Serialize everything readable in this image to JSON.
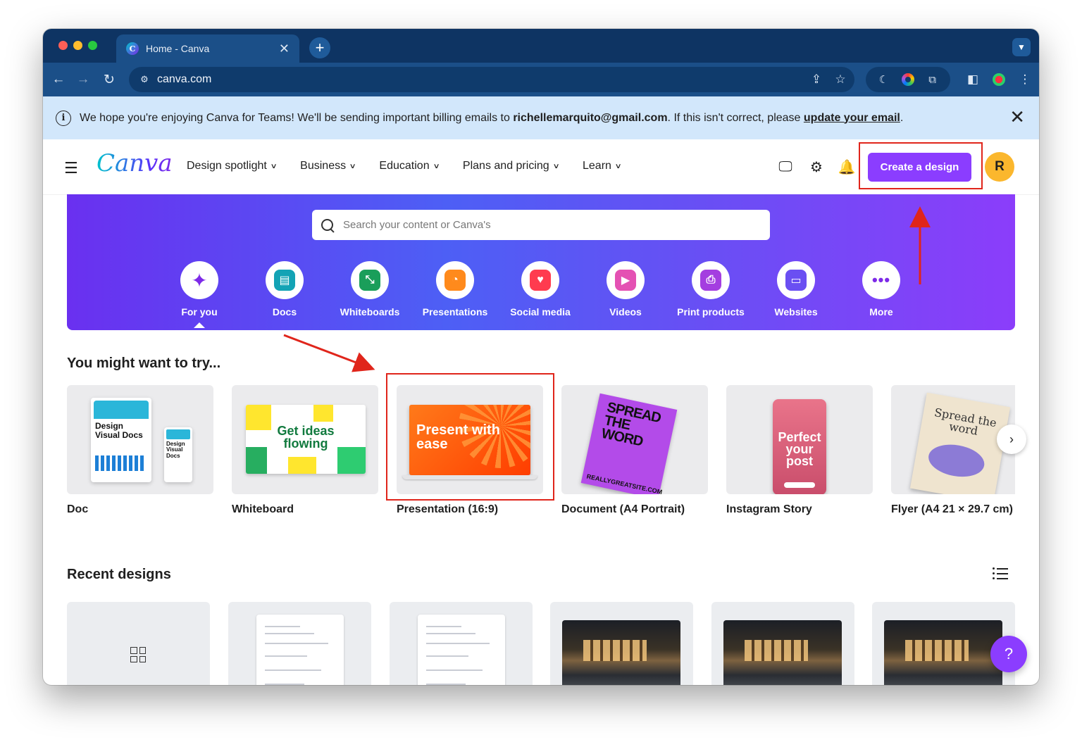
{
  "browser": {
    "tab_title": "Home - Canva",
    "tab_favicon": "C",
    "new_tab_label": "+",
    "url": "canva.com"
  },
  "banner": {
    "text_before": "We hope you're enjoying Canva for Teams! We'll be sending important billing emails to ",
    "email": "richellemarquito@gmail.com",
    "text_middle": ". If this isn't correct, please ",
    "link": "update your email",
    "text_after": "."
  },
  "header": {
    "logo": "Canva",
    "nav": [
      {
        "label": "Design spotlight"
      },
      {
        "label": "Business"
      },
      {
        "label": "Education"
      },
      {
        "label": "Plans and pricing"
      },
      {
        "label": "Learn"
      }
    ],
    "create_button": "Create a design",
    "avatar_initial": "R"
  },
  "hero": {
    "search_placeholder": "Search your content or Canva's",
    "categories": [
      {
        "label": "For you",
        "icon": "sparkle-icon",
        "color": "#7d2ae8"
      },
      {
        "label": "Docs",
        "icon": "docs-icon",
        "color": "#13a3b5"
      },
      {
        "label": "Whiteboards",
        "icon": "whiteboard-icon",
        "color": "#1a9e5a"
      },
      {
        "label": "Presentations",
        "icon": "presentation-icon",
        "color": "#ff8a1c"
      },
      {
        "label": "Social media",
        "icon": "heart-icon",
        "color": "#ff3b4f"
      },
      {
        "label": "Videos",
        "icon": "video-icon",
        "color": "#e451b3"
      },
      {
        "label": "Print products",
        "icon": "printer-icon",
        "color": "#a43ee0"
      },
      {
        "label": "Websites",
        "icon": "website-icon",
        "color": "#6a4ff2"
      },
      {
        "label": "More",
        "icon": "more-icon",
        "color": "#7d2ae8"
      }
    ]
  },
  "suggestions": {
    "title": "You might want to try...",
    "items": [
      {
        "label": "Doc"
      },
      {
        "label": "Whiteboard"
      },
      {
        "label": "Presentation (16:9)"
      },
      {
        "label": "Document (A4 Portrait)"
      },
      {
        "label": "Instagram Story"
      },
      {
        "label": "Flyer (A4 21 × 29.7 cm)"
      }
    ],
    "art": {
      "doc_big": "Design Visual Docs",
      "doc_small": "Design Visual Docs",
      "whiteboard": "Get ideas flowing",
      "presentation": "Present with ease",
      "a4": "SPREAD THE WORD",
      "a4_footer": "REALLYGREATSITE.COM",
      "instagram": "Perfect your post",
      "flyer": "Spread the word"
    }
  },
  "recent": {
    "title": "Recent designs"
  },
  "help_label": "?",
  "colors": {
    "accent": "#8b3dff",
    "annotation": "#e0251b",
    "browser_chrome": "#0e3463"
  }
}
